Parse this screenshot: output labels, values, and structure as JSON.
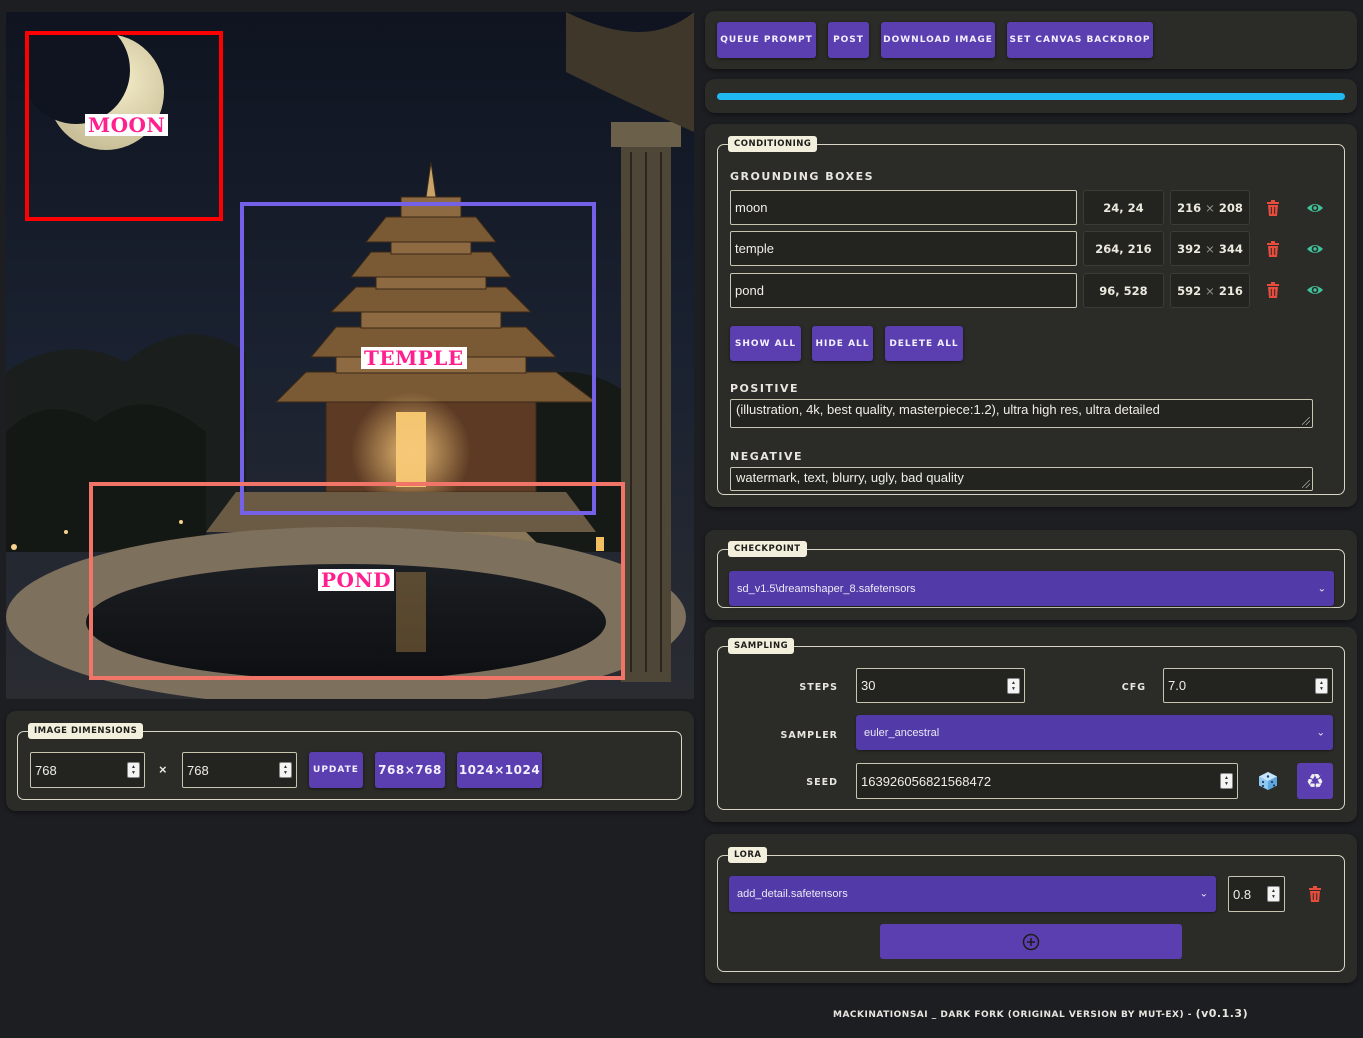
{
  "colors": {
    "accent": "#5b3fb0",
    "progress": "#1fb8f0",
    "trash": "#e74c3c",
    "eye": "#3fc29a",
    "moon_box": "#ff0000",
    "temple_box": "#7560e8",
    "pond_box": "#f07468"
  },
  "toolbar": {
    "queue_prompt": "QUEUE PROMPT",
    "post": "POST",
    "download_image": "DOWNLOAD IMAGE",
    "set_canvas_backdrop": "SET CANVAS BACKDROP"
  },
  "progress": {
    "fraction": 1.0
  },
  "canvas": {
    "labels": {
      "moon": "MOON",
      "temple": "TEMPLE",
      "pond": "POND"
    }
  },
  "image_dimensions": {
    "legend": "IMAGE DIMENSIONS",
    "width": "768",
    "times": "×",
    "height": "768",
    "update": "UPDATE",
    "preset_1": "768×768",
    "preset_2": "1024×1024"
  },
  "conditioning": {
    "legend": "CONDITIONING",
    "grounding_title": "GROUNDING BOXES",
    "boxes": [
      {
        "name": "moon",
        "pos": "24, 24",
        "w": "216",
        "h": "208"
      },
      {
        "name": "temple",
        "pos": "264, 216",
        "w": "392",
        "h": "344"
      },
      {
        "name": "pond",
        "pos": "96, 528",
        "w": "592",
        "h": "216"
      }
    ],
    "size_sep": "×",
    "show_all": "SHOW ALL",
    "hide_all": "HIDE ALL",
    "delete_all": "DELETE ALL",
    "positive_label": "POSITIVE",
    "positive": "(illustration, 4k, best quality, masterpiece:1.2), ultra high res, ultra detailed",
    "negative_label": "NEGATIVE",
    "negative": "watermark, text, blurry, ugly, bad quality"
  },
  "checkpoint": {
    "legend": "CHECKPOINT",
    "value": "sd_v1.5\\dreamshaper_8.safetensors"
  },
  "sampling": {
    "legend": "SAMPLING",
    "steps_label": "STEPS",
    "steps": "30",
    "cfg_label": "CFG",
    "cfg": "7.0",
    "sampler_label": "SAMPLER",
    "sampler": "euler_ancestral",
    "seed_label": "SEED",
    "seed": "163926056821568472"
  },
  "lora": {
    "legend": "LORA",
    "value": "add_detail.safetensors",
    "strength": "0.8"
  },
  "footer": {
    "text": "MACKINATIONSAI _ DARK FORK (ORIGINAL VERSION BY MUT-EX) - ",
    "version": "(v0.1.3)"
  }
}
